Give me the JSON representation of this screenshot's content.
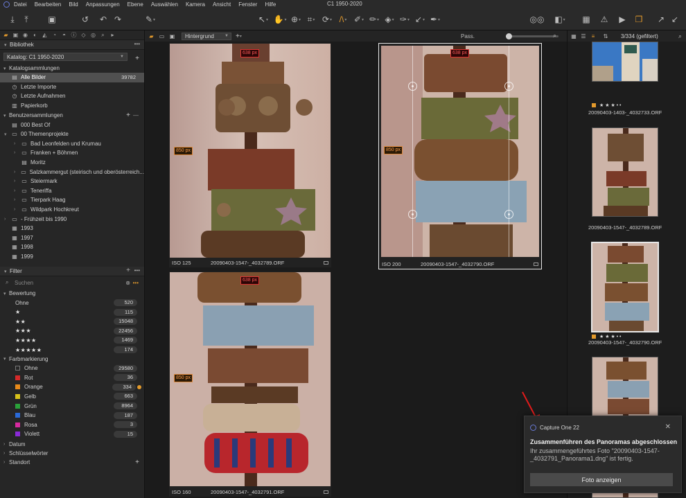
{
  "window": {
    "title": "C1 1950-2020"
  },
  "menu": [
    "Datei",
    "Bearbeiten",
    "Bild",
    "Anpassungen",
    "Ebene",
    "Auswählen",
    "Kamera",
    "Ansicht",
    "Fenster",
    "Hilfe"
  ],
  "library": {
    "title": "Bibliothek",
    "catalog": "Katalog: C1 1950-2020",
    "catalog_collections_title": "Katalogsammlungen",
    "catalog_items": [
      {
        "label": "Alle Bilder",
        "count": "39782",
        "icon": "images-icon",
        "selected": true
      },
      {
        "label": "Letzte Importe",
        "icon": "clock-icon"
      },
      {
        "label": "Letzte Aufnahmen",
        "icon": "clock-icon"
      },
      {
        "label": "Papierkorb",
        "icon": "trash-icon"
      }
    ],
    "user_collections_title": "Benutzersammlungen",
    "user_items": [
      {
        "label": "000 Best Of",
        "icon": "album-icon",
        "level": 0
      },
      {
        "label": "00 Themenprojekte",
        "icon": "folder-icon",
        "level": 0,
        "expanded": true
      },
      {
        "label": "Bad Leonfelden und Krumau",
        "icon": "folder-icon",
        "level": 1
      },
      {
        "label": "Franken + Böhmen",
        "icon": "folder-icon",
        "level": 1
      },
      {
        "label": "Moritz",
        "icon": "album-icon",
        "level": 1
      },
      {
        "label": "Salzkammergut (steirisch und oberösterreich...",
        "icon": "folder-icon",
        "level": 1
      },
      {
        "label": "Steiermark",
        "icon": "folder-icon",
        "level": 1
      },
      {
        "label": "Teneriffa",
        "icon": "folder-icon",
        "level": 1
      },
      {
        "label": "Tierpark Haag",
        "icon": "folder-icon",
        "level": 1
      },
      {
        "label": "Wildpark Hochkreut",
        "icon": "folder-icon",
        "level": 1
      },
      {
        "label": "- Frühzeit bis 1990",
        "icon": "folder-icon",
        "level": 0
      },
      {
        "label": "1993",
        "icon": "project-icon",
        "level": 0
      },
      {
        "label": "1997",
        "icon": "project-icon",
        "level": 0
      },
      {
        "label": "1998",
        "icon": "project-icon",
        "level": 0
      },
      {
        "label": "1999",
        "icon": "project-icon",
        "level": 0
      }
    ]
  },
  "filter": {
    "title": "Filter",
    "search_placeholder": "Suchen",
    "rating_title": "Bewertung",
    "ratings": [
      {
        "label": "Ohne",
        "count": "520"
      },
      {
        "label": "★",
        "count": "115"
      },
      {
        "label": "★★",
        "count": "15048"
      },
      {
        "label": "★★★",
        "count": "22456"
      },
      {
        "label": "★★★★",
        "count": "1469"
      },
      {
        "label": "★★★★★",
        "count": "174"
      }
    ],
    "color_title": "Farbmarkierung",
    "colors": [
      {
        "label": "Ohne",
        "count": "29580",
        "color": "none"
      },
      {
        "label": "Rot",
        "count": "36",
        "color": "#d62a2a"
      },
      {
        "label": "Orange",
        "count": "334",
        "color": "#e88a1a"
      },
      {
        "label": "Gelb",
        "count": "663",
        "color": "#d8c21a"
      },
      {
        "label": "Grün",
        "count": "8964",
        "color": "#2aa23a"
      },
      {
        "label": "Blau",
        "count": "187",
        "color": "#2a6ad8"
      },
      {
        "label": "Rosa",
        "count": "3",
        "color": "#d82aa0"
      },
      {
        "label": "Violett",
        "count": "15",
        "color": "#8a2ad8"
      }
    ],
    "date_title": "Datum",
    "keywords_title": "Schlüsselwörter",
    "location_title": "Standort"
  },
  "viewer": {
    "layer": "Hintergrund",
    "pass_label": "Pass.",
    "images": [
      {
        "iso": "ISO 125",
        "file": "20090403-1547-_4032789.ORF",
        "w_label": "638 px",
        "h_label": "850 px"
      },
      {
        "iso": "ISO 200",
        "file": "20090403-1547-_4032790.ORF",
        "w_label": "638 px",
        "h_label": "850 px"
      },
      {
        "iso": "ISO 160",
        "file": "20090403-1547-_4032791.ORF",
        "w_label": "638 px",
        "h_label": "850 px"
      }
    ]
  },
  "browser": {
    "count": "3/334 (gefiltert)",
    "items": [
      {
        "file": "20090403-1403-_4032733.ORF"
      },
      {
        "file": "20090403-1547-_4032789.ORF"
      },
      {
        "file": "20090403-1547-_4032790.ORF"
      }
    ]
  },
  "notification": {
    "app": "Capture One 22",
    "title": "Zusammenführen des Panoramas abgeschlossen",
    "body": "Ihr zusammengeführtes Foto \"20090403-1547-_4032791_Panorama1.dng\" ist fertig.",
    "button": "Foto anzeigen"
  },
  "colors": {
    "accent": "#e39a2c",
    "selection": "#505050"
  }
}
